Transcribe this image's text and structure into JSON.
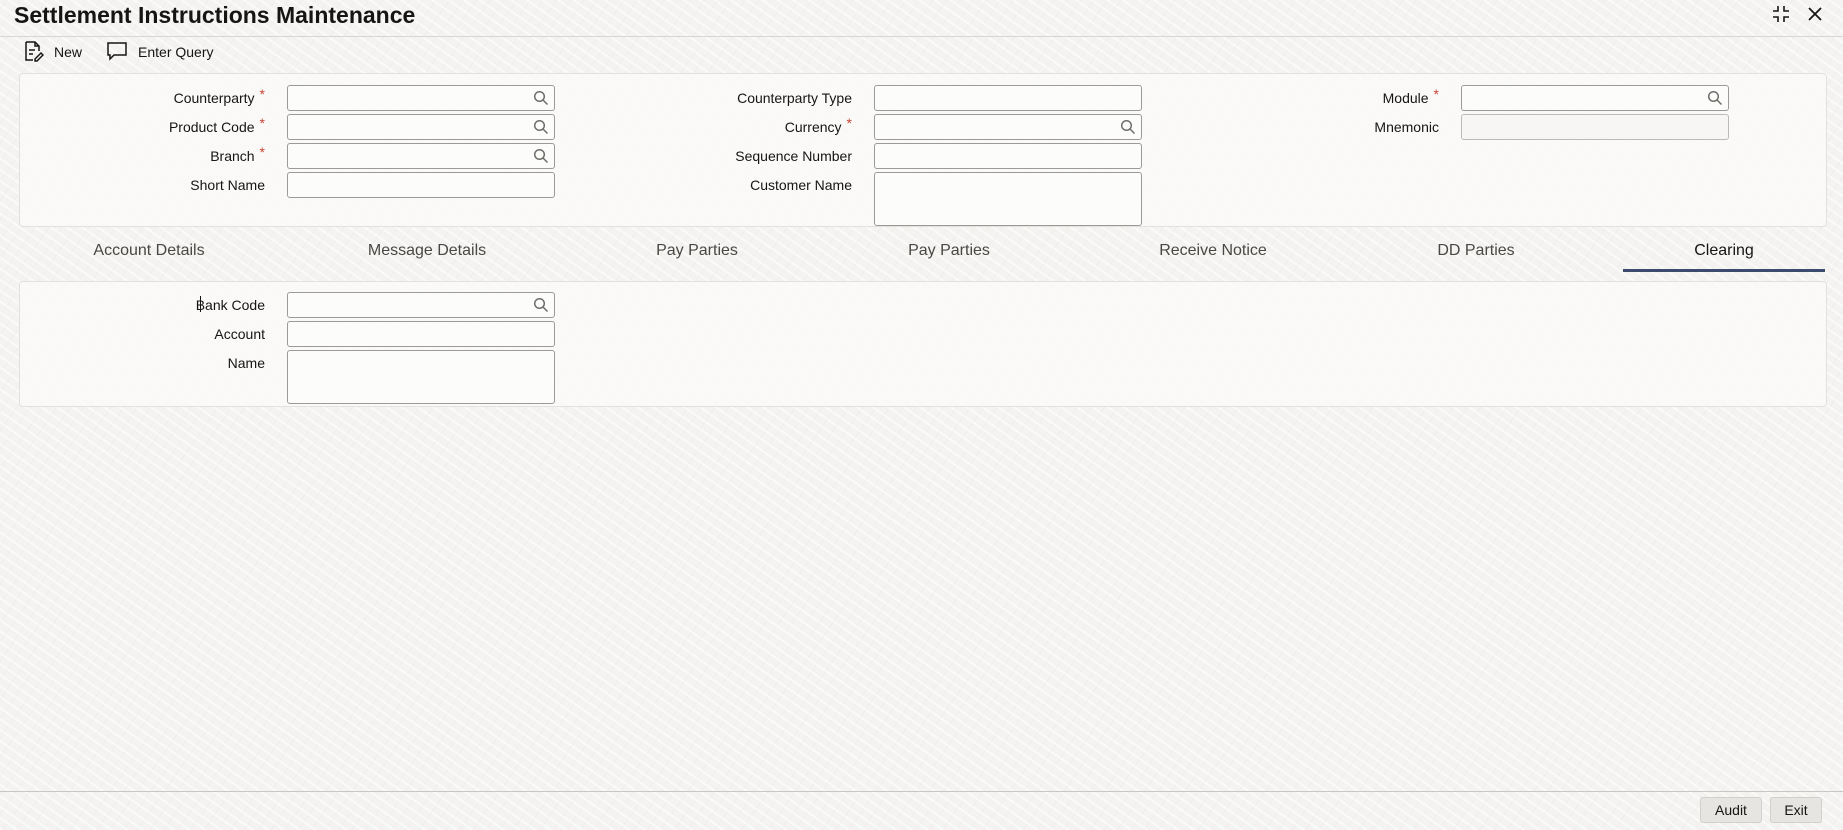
{
  "window": {
    "title": "Settlement Instructions Maintenance",
    "icons": [
      "collapse-icon",
      "close-icon"
    ]
  },
  "toolbar": {
    "new_label": "New",
    "enter_query_label": "Enter Query"
  },
  "header_form": {
    "counterparty_label": "Counterparty",
    "product_code_label": "Product Code",
    "branch_label": "Branch",
    "short_name_label": "Short Name",
    "counterparty_type_label": "Counterparty Type",
    "currency_label": "Currency",
    "sequence_number_label": "Sequence Number",
    "customer_name_label": "Customer Name",
    "module_label": "Module",
    "mnemonic_label": "Mnemonic",
    "required_mark": "*",
    "counterparty_value": "",
    "product_code_value": "",
    "branch_value": "",
    "short_name_value": "",
    "counterparty_type_value": "",
    "currency_value": "",
    "sequence_number_value": "",
    "customer_name_value": "",
    "module_value": "",
    "mnemonic_value": ""
  },
  "tabs": [
    {
      "label": "Account Details",
      "active": false
    },
    {
      "label": "Message Details",
      "active": false
    },
    {
      "label": "Pay Parties",
      "active": false
    },
    {
      "label": "Pay Parties",
      "active": false
    },
    {
      "label": "Receive Notice",
      "active": false
    },
    {
      "label": "DD Parties",
      "active": false
    },
    {
      "label": "Clearing",
      "active": true
    }
  ],
  "clearing": {
    "bank_code_label": "Bank Code",
    "account_label": "Account",
    "name_label": "Name",
    "bank_code_value": "",
    "account_value": "",
    "name_value": ""
  },
  "footer": {
    "audit_label": "Audit",
    "exit_label": "Exit"
  },
  "colors": {
    "required": "#c74634",
    "active_tab_underline": "#3c4a6e",
    "text": "#161513"
  }
}
